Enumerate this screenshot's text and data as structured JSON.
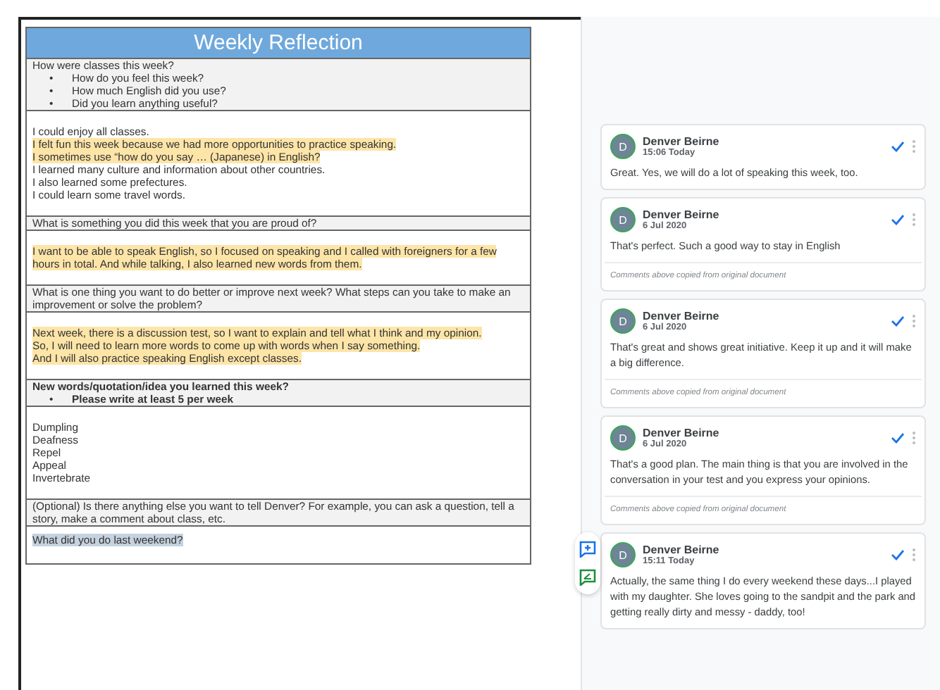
{
  "document": {
    "title": "Weekly Reflection",
    "rows": [
      {
        "kind": "question",
        "bold": false,
        "text": "How were classes this week?",
        "bullets": [
          {
            "marker": "•",
            "text": "How do you feel this week?"
          },
          {
            "marker": "•",
            "text": "How much English did you use?"
          },
          {
            "marker": "•",
            "text": "Did you learn anything useful?"
          }
        ]
      },
      {
        "kind": "answer",
        "lines": [
          {
            "text": "I could enjoy all classes.",
            "highlighted": false,
            "selected": false
          },
          {
            "text": "I felt fun this week because we had more opportunities to practice speaking.",
            "highlighted": true,
            "selected": false
          },
          {
            "text": "I sometimes use “how do you say … (Japanese) in English?",
            "highlighted": true,
            "selected": false
          },
          {
            "text": "I learned many culture and information about other countries.",
            "highlighted": false,
            "selected": false
          },
          {
            "text": "I also learned some prefectures.",
            "highlighted": false,
            "selected": false
          },
          {
            "text": "I could learn some travel words.",
            "highlighted": false,
            "selected": false
          }
        ]
      },
      {
        "kind": "question",
        "bold": false,
        "text": "What is something you did this week that you are proud of?"
      },
      {
        "kind": "answer",
        "lines": [
          {
            "text": "I want to be able to speak English, so I focused on speaking and I called with foreigners for a few",
            "highlighted": true,
            "selected": false
          },
          {
            "text": "hours in total. And while talking, I also learned new words from them.",
            "highlighted": true,
            "selected": false
          }
        ]
      },
      {
        "kind": "question",
        "bold": false,
        "text": "What is one thing you want to do better or improve next week? What steps can you take to make an improvement or solve the problem?"
      },
      {
        "kind": "answer",
        "lines": [
          {
            "text": "Next week, there is a discussion test, so I want to explain and tell what I think and my opinion.",
            "highlighted": true,
            "selected": false
          },
          {
            "text": "So, I will need to learn more words to come up with words when I say something.",
            "highlighted": true,
            "selected": false
          },
          {
            "text": "And I will also practice speaking English except classes.",
            "highlighted": true,
            "selected": false
          }
        ]
      },
      {
        "kind": "question",
        "bold": true,
        "text": "New words/quotation/idea you learned this week?",
        "bullets": [
          {
            "marker": "•",
            "text": "Please write at least 5 per week"
          }
        ]
      },
      {
        "kind": "answer",
        "lines": [
          {
            "text": "Dumpling",
            "highlighted": false,
            "selected": false
          },
          {
            "text": "Deafness",
            "highlighted": false,
            "selected": false
          },
          {
            "text": "Repel",
            "highlighted": false,
            "selected": false
          },
          {
            "text": "Appeal",
            "highlighted": false,
            "selected": false
          },
          {
            "text": "Invertebrate",
            "highlighted": false,
            "selected": false
          }
        ]
      },
      {
        "kind": "question",
        "bold": false,
        "text": "(Optional) Is there anything else you want to tell Denver? For example, you can ask a question, tell a story, make a comment about class, etc."
      },
      {
        "kind": "answer",
        "lines": [
          {
            "text": "What did you do last weekend?",
            "highlighted": false,
            "selected": true
          }
        ]
      }
    ]
  },
  "comments": [
    {
      "avatar_letter": "D",
      "author": "Denver Beirne",
      "time": "15:06 Today",
      "text": "Great. Yes, we will do a lot of speaking this week, too."
    },
    {
      "avatar_letter": "D",
      "author": "Denver Beirne",
      "time": "6 Jul 2020",
      "text": "That's perfect. Such a good way to stay in English",
      "footer": "Comments above copied from original document"
    },
    {
      "avatar_letter": "D",
      "author": "Denver Beirne",
      "time": "6 Jul 2020",
      "text": "That's great and shows great initiative. Keep it up and it will make a big difference.",
      "footer": "Comments above copied from original document"
    },
    {
      "avatar_letter": "D",
      "author": "Denver Beirne",
      "time": "6 Jul 2020",
      "text": "That's a good plan. The main thing is that you are involved in the conversation in your test and you express your opinions.",
      "footer": "Comments above copied from original document"
    },
    {
      "avatar_letter": "D",
      "author": "Denver Beirne",
      "time": "15:11 Today",
      "text": "Actually, the same thing I do every weekend these days...I played with my daughter. She loves going to the sandpit and the park and getting really dirty and messy - daddy, too!"
    }
  ]
}
